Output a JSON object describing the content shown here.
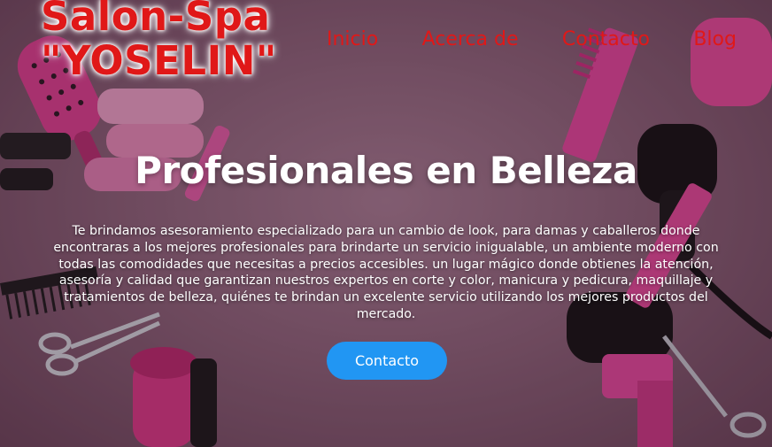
{
  "brand": {
    "line1": "Salon-Spa",
    "line2": "\"YOSELIN\""
  },
  "nav": {
    "items": [
      "Inicio",
      "Acerca de",
      "Contacto",
      "Blog"
    ]
  },
  "hero": {
    "title": "Profesionales en Belleza",
    "body": "Te brindamos asesoramiento especializado para un cambio de look, para damas y caballeros donde encontraras a los mejores profesionales para brindarte un servicio inigualable, un ambiente moderno con todas las comodidades que necesitas a precios accesibles. un lugar mágico donde obtienes la atención, asesoría y calidad que garantizan nuestros expertos en corte y color, manicura y pedicura, maquillaje y tratamientos de belleza, quiénes te brindan un excelente servicio utilizando los mejores productos del mercado.",
    "cta_label": "Contacto"
  },
  "colors": {
    "brand_red": "#e01818",
    "cta_blue": "#2196f3",
    "background": "#8b6479"
  }
}
